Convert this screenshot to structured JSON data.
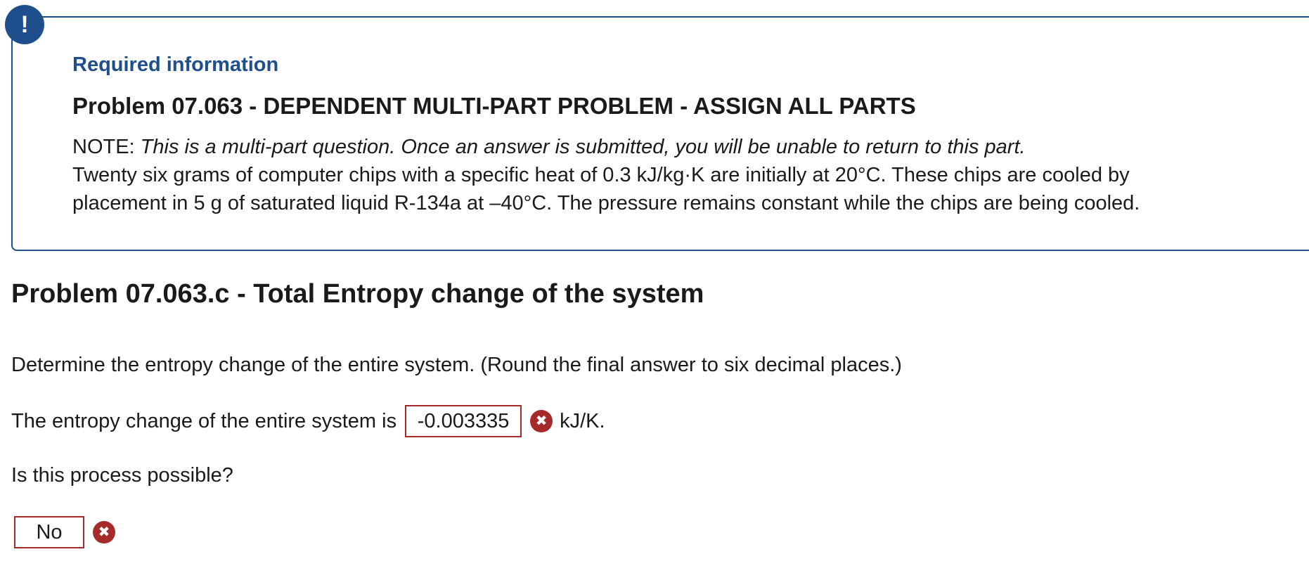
{
  "required_info": {
    "label": "Required information",
    "title": "Problem 07.063 - DEPENDENT MULTI-PART PROBLEM - ASSIGN ALL PARTS",
    "note_prefix": "NOTE: ",
    "note_text": "This is a multi-part question. Once an answer is submitted, you will be unable to return to this part.",
    "statement_line1": "Twenty six grams of computer chips with a specific heat of 0.3 kJ/kg·K are initially at 20°C. These chips are cooled by",
    "statement_line2": "placement in 5 g of saturated liquid R-134a at –40°C. The pressure remains constant while the chips are being cooled.",
    "alert_icon": "exclamation-icon",
    "alert_symbol": "!"
  },
  "part": {
    "title": "Problem 07.063.c - Total Entropy change of the system",
    "question": "Determine the entropy change of the entire system. (Round the final answer to six decimal places.)",
    "answer_prefix": "The entropy change of the entire system is",
    "answer_value": "-0.003335",
    "answer_unit": "kJ/K.",
    "answer_status_icon": "incorrect-icon",
    "incorrect_symbol": "✖",
    "question2": "Is this process possible?",
    "select_value": "No",
    "select_status_icon": "incorrect-icon"
  },
  "colors": {
    "accent": "#1f4e8c",
    "error": "#a52a2a",
    "text": "#1a1a1a"
  }
}
